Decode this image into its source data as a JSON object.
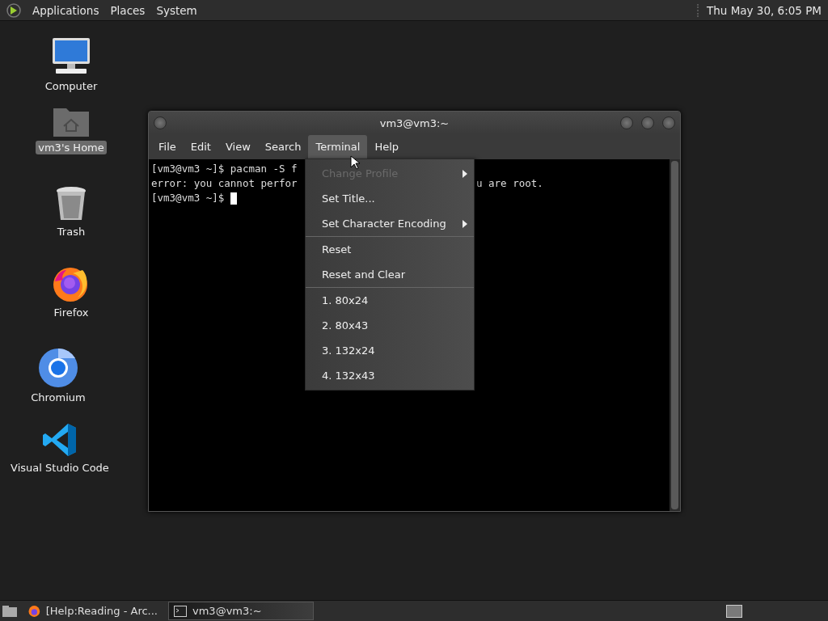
{
  "top_panel": {
    "menus": [
      "Applications",
      "Places",
      "System"
    ],
    "clock": "Thu May 30, 6:05 PM"
  },
  "desktop_icons": [
    {
      "kind": "computer",
      "label": "Computer",
      "selected": false
    },
    {
      "kind": "home",
      "label": "vm3's Home",
      "selected": true
    },
    {
      "kind": "trash",
      "label": "Trash",
      "selected": false
    },
    {
      "kind": "firefox",
      "label": "Firefox",
      "selected": false
    },
    {
      "kind": "chromium",
      "label": "Chromium",
      "selected": false
    },
    {
      "kind": "vscode",
      "label": "Visual Studio Code",
      "selected": false
    }
  ],
  "terminal_window": {
    "title": "vm3@vm3:~",
    "menus": [
      {
        "label": "File",
        "selected": false
      },
      {
        "label": "Edit",
        "selected": false
      },
      {
        "label": "View",
        "selected": false
      },
      {
        "label": "Search",
        "selected": false
      },
      {
        "label": "Terminal",
        "selected": true
      },
      {
        "label": "Help",
        "selected": false
      }
    ],
    "lines": [
      {
        "parts": [
          "[vm3@vm3 ~]$ pacman -S f"
        ]
      },
      {
        "parts": [
          "error: you cannot perfor",
          "u are root."
        ]
      },
      {
        "parts": [
          "[vm3@vm3 ~]$ "
        ],
        "cursor": true
      }
    ]
  },
  "terminal_menu": {
    "groups": [
      [
        {
          "label": "Change Profile",
          "disabled": true,
          "submenu": true
        },
        {
          "label": "Set Title...",
          "disabled": false,
          "submenu": false
        },
        {
          "label": "Set Character Encoding",
          "disabled": false,
          "submenu": true
        }
      ],
      [
        {
          "label": "Reset",
          "disabled": false,
          "submenu": false
        },
        {
          "label": "Reset and Clear",
          "disabled": false,
          "submenu": false
        }
      ],
      [
        {
          "label": "1. 80x24",
          "disabled": false,
          "submenu": false
        },
        {
          "label": "2. 80x43",
          "disabled": false,
          "submenu": false
        },
        {
          "label": "3. 132x24",
          "disabled": false,
          "submenu": false
        },
        {
          "label": "4. 132x43",
          "disabled": false,
          "submenu": false
        }
      ]
    ]
  },
  "taskbar": {
    "tasks": [
      {
        "kind": "firefox",
        "label": "[Help:Reading - Arc...",
        "selected": false
      },
      {
        "kind": "terminal",
        "label": "vm3@vm3:~",
        "selected": true
      }
    ]
  }
}
